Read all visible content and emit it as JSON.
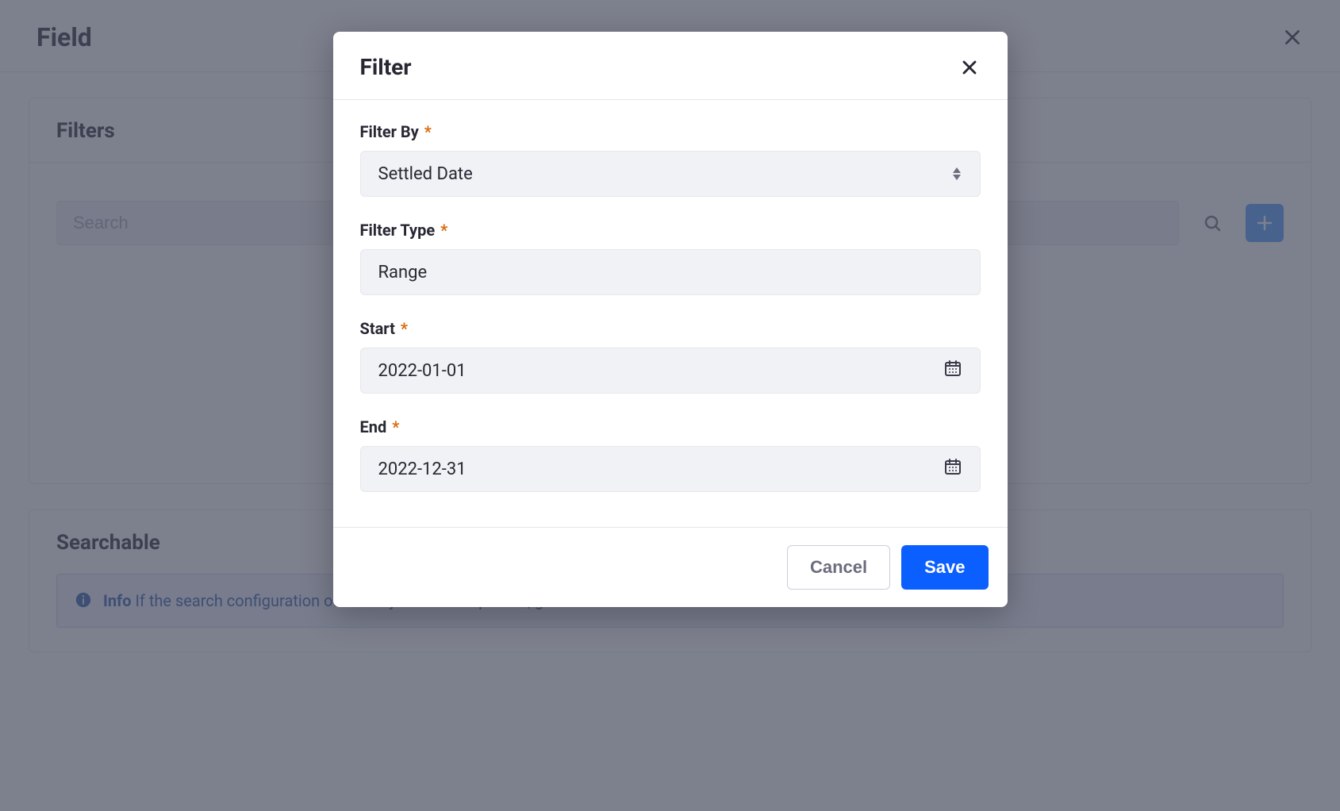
{
  "page": {
    "title": "Field"
  },
  "filtersPanel": {
    "title": "Filters",
    "search": {
      "placeholder": "Search"
    }
  },
  "searchablePanel": {
    "title": "Searchable",
    "info": {
      "label": "Info",
      "text": " If the search configuration of this object field is updated, go to Control Panel > Search > Index Actions and execute the"
    }
  },
  "modal": {
    "title": "Filter",
    "fields": {
      "filterBy": {
        "label": "Filter By",
        "required": "*",
        "value": "Settled Date"
      },
      "filterType": {
        "label": "Filter Type",
        "required": "*",
        "value": "Range"
      },
      "start": {
        "label": "Start",
        "required": "*",
        "value": "2022-01-01"
      },
      "end": {
        "label": "End",
        "required": "*",
        "value": "2022-12-31"
      }
    },
    "buttons": {
      "cancel": "Cancel",
      "save": "Save"
    }
  }
}
